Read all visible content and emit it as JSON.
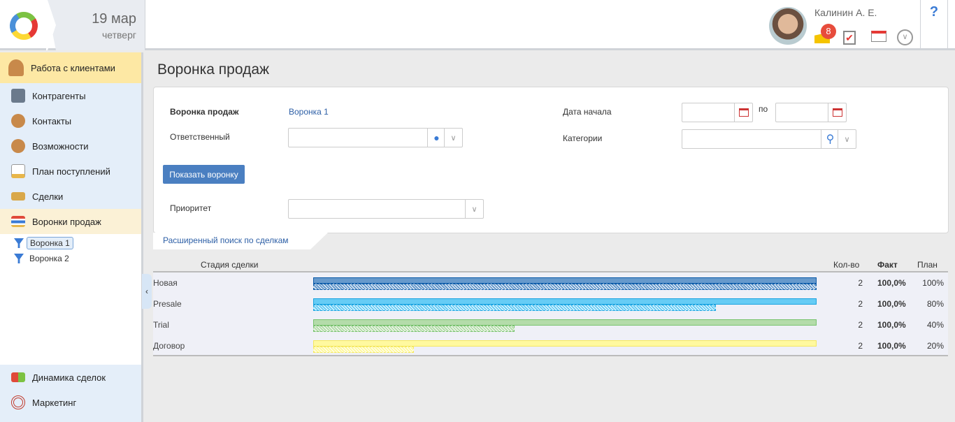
{
  "header": {
    "day": "19 мар",
    "weekday": "четверг",
    "user": "Калинин А. Е.",
    "mail_badge": "8",
    "help": "?"
  },
  "sidebar": {
    "section": "Работа с клиентами",
    "items": [
      {
        "label": "Контрагенты",
        "color": "#6b7a8c"
      },
      {
        "label": "Контакты",
        "color": "#c8894a"
      },
      {
        "label": "Возможности",
        "color": "#c8894a"
      },
      {
        "label": "План поступлений",
        "color": "#e8b64a"
      },
      {
        "label": "Сделки",
        "color": "#d9a84a"
      },
      {
        "label": "Воронки продаж",
        "color": "#e04a3a"
      }
    ],
    "tree": [
      "Воронка 1",
      "Воронка 2"
    ],
    "bottom": [
      {
        "label": "Динамика сделок",
        "color": "#e04a3a"
      },
      {
        "label": "Маркетинг",
        "color": "#c0392b"
      }
    ]
  },
  "page": {
    "title": "Воронка продаж"
  },
  "form": {
    "funnel_label": "Воронка продаж",
    "funnel_value": "Воронка 1",
    "owner_label": "Ответственный",
    "date_label": "Дата начала",
    "date_to": "по",
    "cat_label": "Категории",
    "show_button": "Показать воронку",
    "priority_label": "Приоритет",
    "advanced": "Расширенный поиск по сделкам"
  },
  "table": {
    "headers": {
      "stage": "Стадия сделки",
      "count": "Кол-во",
      "fact": "Факт",
      "plan": "План"
    },
    "rows": [
      {
        "stage": "Новая",
        "count": "2",
        "fact": "100,0%",
        "plan": "100%",
        "fact_value": 100,
        "plan_value": 100,
        "color": "#6699cc",
        "border": "#0b5aa8"
      },
      {
        "stage": "Presale",
        "count": "2",
        "fact": "100,0%",
        "plan": "80%",
        "fact_value": 100,
        "plan_value": 80,
        "color": "#66ccf5",
        "border": "#1aa3e0"
      },
      {
        "stage": "Trial",
        "count": "2",
        "fact": "100,0%",
        "plan": "40%",
        "fact_value": 100,
        "plan_value": 40,
        "color": "#b4dcaa",
        "border": "#78c26e"
      },
      {
        "stage": "Договор",
        "count": "2",
        "fact": "100,0%",
        "plan": "20%",
        "fact_value": 100,
        "plan_value": 20,
        "color": "#fff9a0",
        "border": "#f5e860"
      }
    ]
  }
}
